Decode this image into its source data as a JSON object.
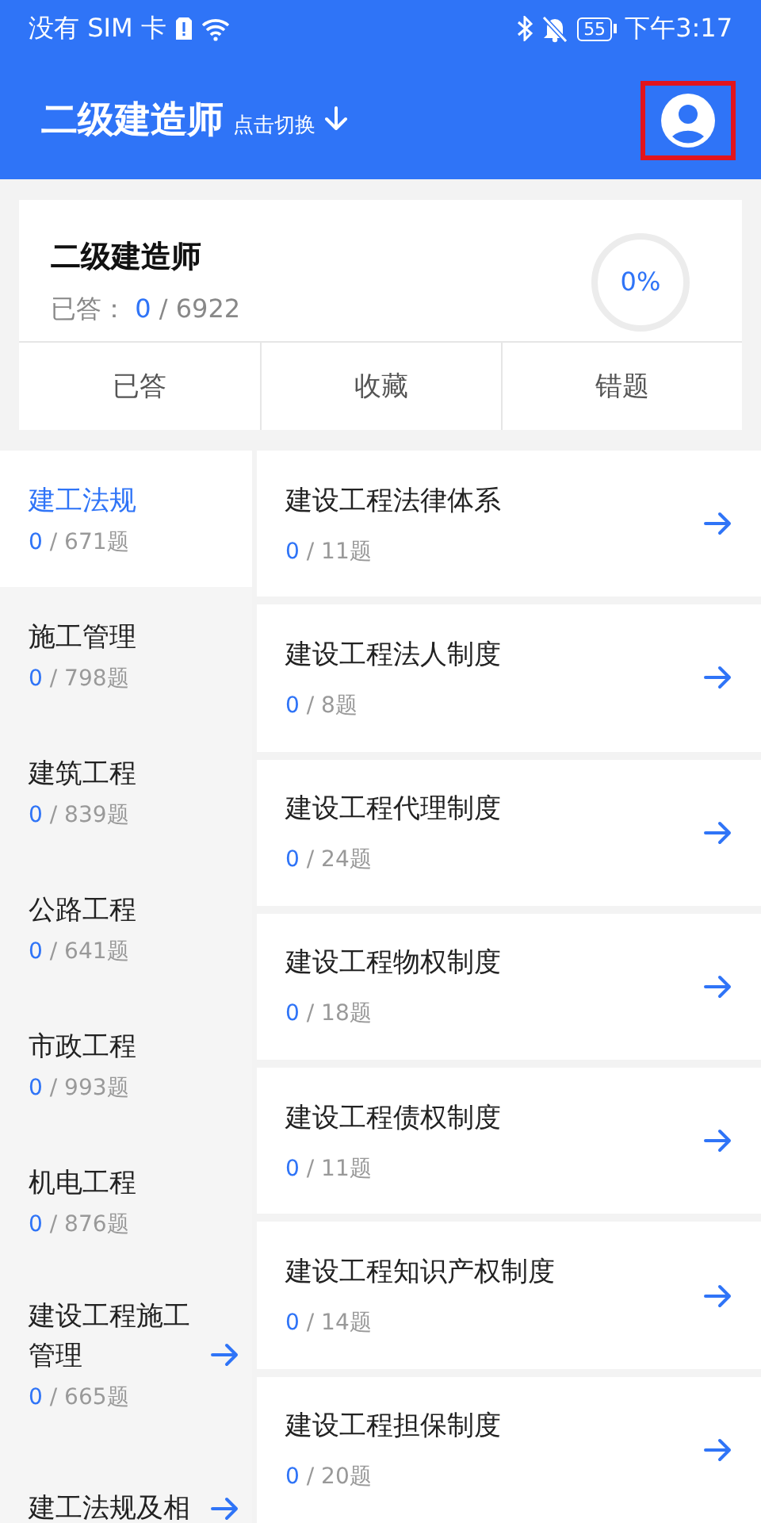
{
  "status_bar": {
    "carrier": "没有 SIM 卡",
    "battery": "55",
    "time": "下午3:17"
  },
  "header": {
    "title": "二级建造师",
    "switch_hint": "点击切换",
    "profile_highlighted": true
  },
  "summary": {
    "title": "二级建造师",
    "answered_label": "已答：",
    "answered": "0",
    "total": "/ 6922",
    "percent": "0%",
    "tabs": [
      "已答",
      "收藏",
      "错题"
    ]
  },
  "categories": [
    {
      "name": "建工法规",
      "answered": "0",
      "total": "/ 671题",
      "selected": true,
      "arrow": false
    },
    {
      "name": "施工管理",
      "answered": "0",
      "total": "/ 798题",
      "selected": false,
      "arrow": false
    },
    {
      "name": "建筑工程",
      "answered": "0",
      "total": "/ 839题",
      "selected": false,
      "arrow": false
    },
    {
      "name": "公路工程",
      "answered": "0",
      "total": "/ 641题",
      "selected": false,
      "arrow": false
    },
    {
      "name": "市政工程",
      "answered": "0",
      "total": "/ 993题",
      "selected": false,
      "arrow": false
    },
    {
      "name": "机电工程",
      "answered": "0",
      "total": "/ 876题",
      "selected": false,
      "arrow": false
    },
    {
      "name": "建设工程施工管理",
      "answered": "0",
      "total": "/ 665题",
      "selected": false,
      "arrow": true
    },
    {
      "name": "建工法规及相",
      "selected": false,
      "arrow": true
    }
  ],
  "topics": [
    {
      "name": "建设工程法律体系",
      "answered": "0",
      "total": "/ 11题"
    },
    {
      "name": "建设工程法人制度",
      "answered": "0",
      "total": "/ 8题"
    },
    {
      "name": "建设工程代理制度",
      "answered": "0",
      "total": "/ 24题"
    },
    {
      "name": "建设工程物权制度",
      "answered": "0",
      "total": "/ 18题"
    },
    {
      "name": "建设工程债权制度",
      "answered": "0",
      "total": "/ 11题"
    },
    {
      "name": "建设工程知识产权制度",
      "answered": "0",
      "total": "/ 14题"
    },
    {
      "name": "建设工程担保制度",
      "answered": "0",
      "total": "/ 20题"
    }
  ]
}
